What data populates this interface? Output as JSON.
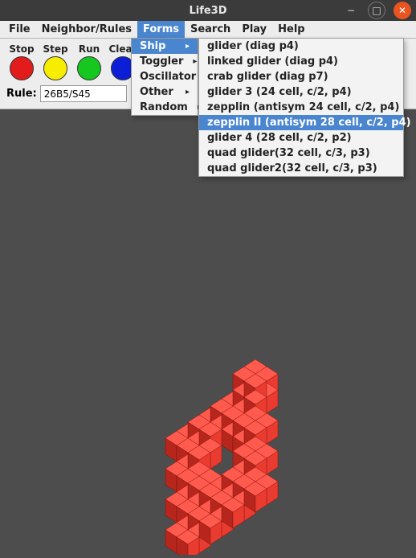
{
  "window": {
    "title": "Life3D"
  },
  "menubar": {
    "items": [
      "File",
      "Neighbor/Rules",
      "Forms",
      "Search",
      "Play",
      "Help"
    ],
    "active_index": 2
  },
  "toolbar": {
    "buttons": [
      {
        "label": "Stop",
        "color": "#e21b1b"
      },
      {
        "label": "Step",
        "color": "#f6ed00"
      },
      {
        "label": "Run",
        "color": "#15c71f"
      },
      {
        "label": "Clear",
        "color": "#0d1fd6"
      }
    ],
    "rule_label": "Rule:",
    "rule_value": "26B5/S45"
  },
  "forms_menu": {
    "items": [
      "Ship",
      "Toggler",
      "Oscillator",
      "Other",
      "Random"
    ],
    "active_index": 0
  },
  "ship_menu": {
    "items": [
      "glider (diag p4)",
      "linked glider (diag p4)",
      "crab glider (diag p7)",
      "glider 3 (24 cell, c/2, p4)",
      "zepplin (antisym 24 cell, c/2, p4)",
      "zepplin II (antisym 28 cell, c/2, p4)",
      "glider 4 (28 cell, c/2, p2)",
      "quad glider(32 cell, c/3, p3)",
      "quad glider2(32 cell, c/3, p3)"
    ],
    "active_index": 5
  },
  "shape": {
    "color_face": "#e73a2f",
    "color_left": "#b22018",
    "color_top": "#ff6b5f"
  }
}
